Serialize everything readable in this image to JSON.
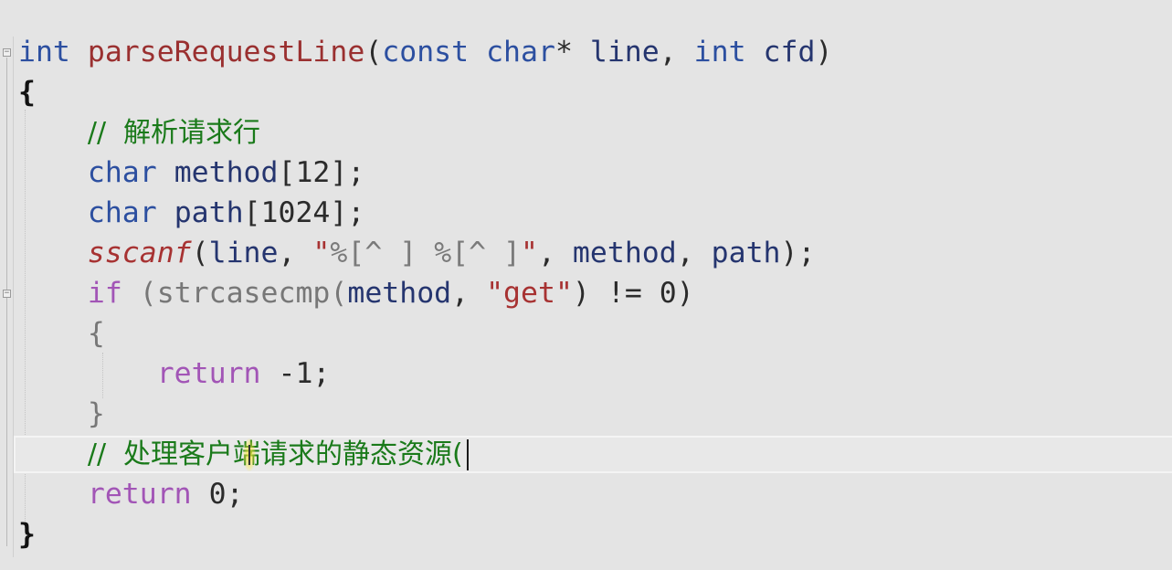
{
  "code": {
    "sig": {
      "ret_type": "int",
      "func": "parseRequestLine",
      "open": "(",
      "const_kw": "const",
      "char_kw": "char",
      "star": "*",
      "arg1": "line",
      "comma": ",",
      "int_kw": "int",
      "arg2": "cfd",
      "close": ")"
    },
    "open_brace": "{",
    "comment1": {
      "slashes": "//",
      "text": "解析请求行"
    },
    "decl1": {
      "type": "char",
      "name": "method",
      "rest": "[12];"
    },
    "decl2": {
      "type": "char",
      "name": "path",
      "rest": "[1024];"
    },
    "call": {
      "func": "sscanf",
      "open": "(",
      "arg1": "line",
      "comma1": ",",
      "q1": "\"",
      "fmt1": "%[^ ]",
      "space": " ",
      "fmt2": "%[^ ]",
      "q2": "\"",
      "comma2": ",",
      "arg3": "method",
      "comma3": ",",
      "arg4": "path",
      "close": ");"
    },
    "cond": {
      "kw": "if",
      "open": "(",
      "func": "strcasecmp",
      "open2": "(",
      "arg": "method",
      "comma": ",",
      "str": "\"get\"",
      "close2": ")",
      "op": "!=",
      "num": "0",
      "close": ")"
    },
    "inner_open": "{",
    "inner_return": {
      "kw": "return",
      "value": "-1;"
    },
    "inner_close": "}",
    "comment2": {
      "slashes": "//",
      "text": "处理客户端请求的静态资源(",
      "text_a": "处理客",
      "text_b": "户端请求的静态资源"
    },
    "final_return": {
      "kw": "return",
      "value": "0;"
    },
    "close_brace": "}"
  },
  "gutter": {
    "fold_glyph": "−"
  }
}
